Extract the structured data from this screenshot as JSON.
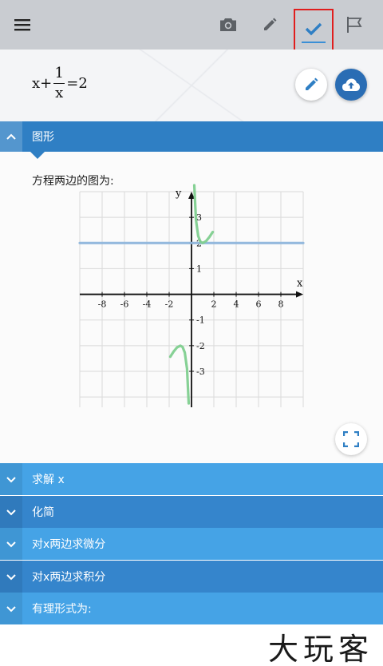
{
  "toolbar": {
    "icons": [
      "menu-icon",
      "camera-icon",
      "pencil-icon",
      "check-icon",
      "flag-icon"
    ],
    "active": "check",
    "highlight_color": "#e01e1e",
    "accent": "#3a8fd6"
  },
  "equation": {
    "lhs_x": "x",
    "plus": "+",
    "frac_num": "1",
    "frac_den": "x",
    "equals": "=",
    "rhs": "2"
  },
  "graph_section": {
    "title": "图形",
    "caption": "方程两边的图为:"
  },
  "chart_data": {
    "type": "line",
    "xlabel": "x",
    "ylabel": "y",
    "xlim": [
      -10,
      10
    ],
    "ylim": [
      -4.4,
      4
    ],
    "x_ticks": [
      "-8",
      "-6",
      "-4",
      "-2",
      "2",
      "4",
      "6",
      "8"
    ],
    "y_ticks": [
      "3",
      "2",
      "1",
      "-1",
      "-2",
      "-3"
    ],
    "series": [
      {
        "color": "#8fb6dc",
        "x": [
          -10,
          10
        ],
        "y": [
          2,
          2
        ]
      },
      {
        "color": "#7fcf8f",
        "x": [
          0.25,
          0.4,
          0.6,
          0.8,
          1.0,
          1.3,
          1.6,
          1.9
        ],
        "y": [
          4.25,
          2.9,
          2.27,
          2.05,
          2.0,
          2.07,
          2.23,
          2.43
        ]
      },
      {
        "color": "#7fcf8f",
        "x": [
          -1.9,
          -1.6,
          -1.3,
          -1.0,
          -0.8,
          -0.6,
          -0.4,
          -0.25
        ],
        "y": [
          -2.43,
          -2.23,
          -2.07,
          -2.0,
          -2.05,
          -2.27,
          -2.9,
          -4.25
        ]
      }
    ],
    "grid": true
  },
  "accordion": [
    {
      "title": "求解 x",
      "tone": "light"
    },
    {
      "title": "化简",
      "tone": "dark"
    },
    {
      "title": "对x两边求微分",
      "tone": "light"
    },
    {
      "title": "对x两边求积分",
      "tone": "dark"
    },
    {
      "title": "有理形式为:",
      "tone": "light"
    }
  ],
  "watermark": "大玩客"
}
